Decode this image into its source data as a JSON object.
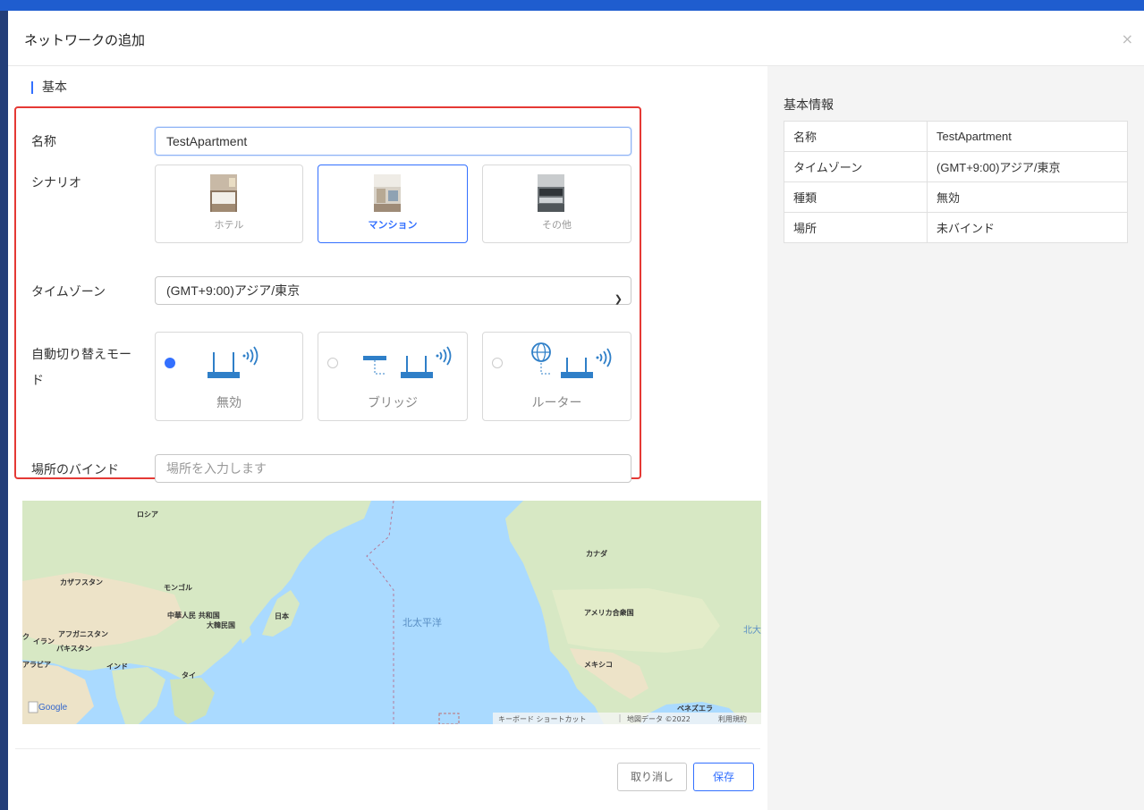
{
  "modal": {
    "title": "ネットワークの追加",
    "close": "×"
  },
  "section": {
    "title": "基本"
  },
  "form": {
    "name": {
      "label": "名称",
      "value": "TestApartment"
    },
    "scenario": {
      "label": "シナリオ",
      "options": [
        {
          "label": "ホテル",
          "selected": false
        },
        {
          "label": "マンション",
          "selected": true
        },
        {
          "label": "その他",
          "selected": false
        }
      ]
    },
    "timezone": {
      "label": "タイムゾーン",
      "value": "(GMT+9:00)アジア/東京"
    },
    "mode": {
      "label_line1": "自動切り替えモー",
      "label_line2": "ド",
      "options": [
        {
          "label": "無効",
          "selected": true,
          "icon": "router-wifi-icon"
        },
        {
          "label": "ブリッジ",
          "selected": false,
          "icon": "bridge-icon"
        },
        {
          "label": "ルーター",
          "selected": false,
          "icon": "internet-router-icon"
        }
      ]
    },
    "location": {
      "label": "場所のバインド",
      "placeholder": "場所を入力します"
    }
  },
  "map": {
    "labels": {
      "russia": "ロシア",
      "kazakhstan": "カザフスタン",
      "mongolia": "モンゴル",
      "china": "中華人民\n共和国",
      "korea": "大韓民国",
      "japan": "日本",
      "afghanistan": "アフガニスタン",
      "iran": "イラン",
      "pakistan": "パキスタン",
      "arabia": "アラビア",
      "india": "インド",
      "thailand": "タイ",
      "pacific": "北太平洋",
      "canada": "カナダ",
      "usa": "アメリカ合衆国",
      "mexico": "メキシコ",
      "venezuela": "ベネズエラ",
      "atlantic_partial": "北大",
      "iraq_partial": "ク"
    },
    "google_logo": "Google",
    "attribution": {
      "shortcuts": "キーボード ショートカット",
      "data": "地図データ ©2022",
      "terms": "利用規約"
    }
  },
  "footer": {
    "cancel": "取り消し",
    "save": "保存"
  },
  "info": {
    "title": "基本情報",
    "rows": [
      {
        "key": "名称",
        "value": "TestApartment"
      },
      {
        "key": "タイムゾーン",
        "value": "(GMT+9:00)アジア/東京"
      },
      {
        "key": "種類",
        "value": "無効"
      },
      {
        "key": "場所",
        "value": "未バインド"
      }
    ]
  },
  "colors": {
    "accent": "#3370ff",
    "highlight": "#e53935",
    "water": "#aadaff",
    "land": "#d7e8c4",
    "desert": "#ede3c8"
  }
}
